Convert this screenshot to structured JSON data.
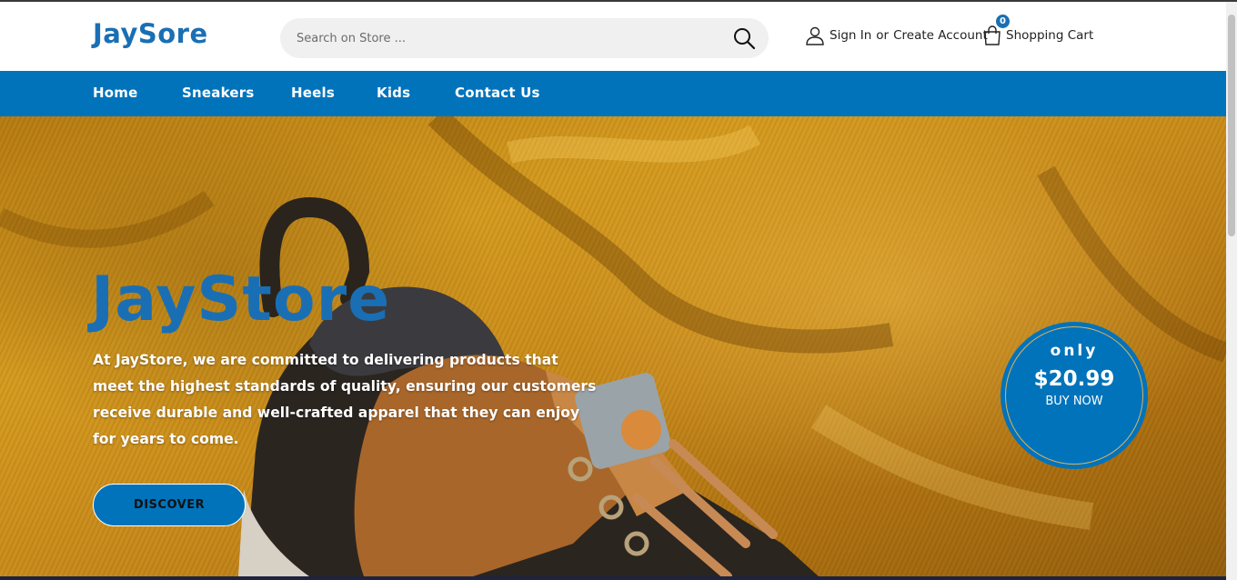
{
  "header": {
    "logo": "JaySore",
    "search_placeholder": "Search on Store ...",
    "sign_in": "Sign In",
    "or": "or",
    "create_account": "Create Account",
    "cart_label": "Shopping Cart",
    "cart_count": "0"
  },
  "nav": {
    "items": [
      {
        "label": "Home"
      },
      {
        "label": "Sneakers"
      },
      {
        "label": "Heels"
      },
      {
        "label": "Kids"
      },
      {
        "label": "Contact Us"
      }
    ]
  },
  "hero": {
    "title": "JayStore",
    "text": "At JayStore, we are committed to delivering products that meet the highest standards of quality, ensuring our customers receive durable and well-crafted apparel that they can enjoy for years to come.",
    "button": "DISCOVER"
  },
  "promo": {
    "only": "only",
    "price": "$20.99",
    "buy": "BUY NOW"
  },
  "colors": {
    "brand": "#0073bb",
    "logo": "#1a6fb4"
  }
}
